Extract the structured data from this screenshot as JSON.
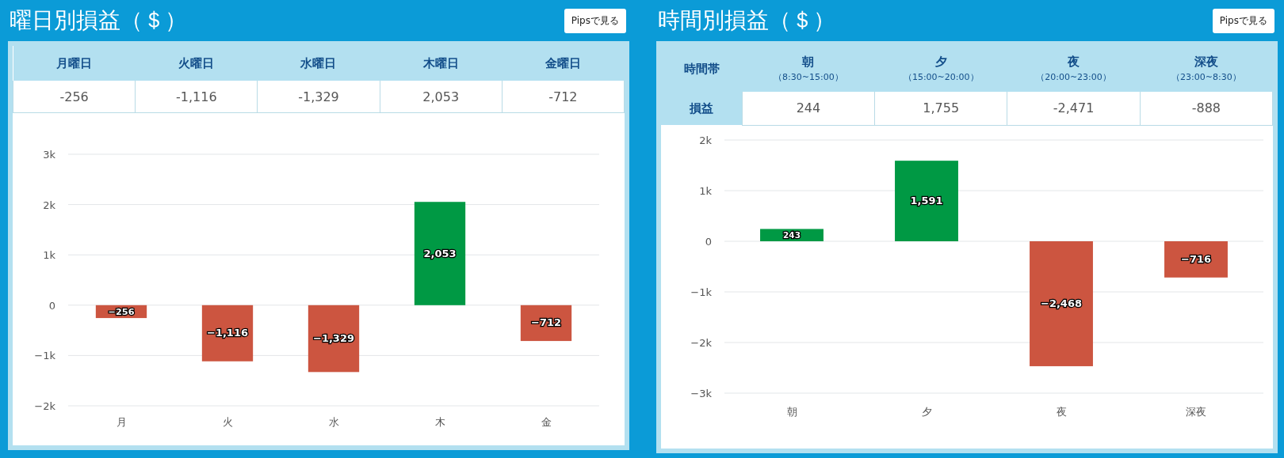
{
  "panels": [
    {
      "title": "曜日別損益（＄）",
      "button": "Pipsで見る",
      "table": {
        "columns": [
          "月曜日",
          "火曜日",
          "水曜日",
          "木曜日",
          "金曜日"
        ],
        "values": [
          "-256",
          "-1,116",
          "-1,329",
          "2,053",
          "-712"
        ]
      },
      "chart_data": {
        "type": "bar",
        "categories": [
          "月",
          "火",
          "水",
          "木",
          "金"
        ],
        "stacked": true,
        "grid": true,
        "series": [
          {
            "color": "#009944",
            "values": [
              null,
              null,
              null,
              2053,
              null
            ]
          },
          {
            "color": "#cc5540",
            "values": [
              -256,
              -1116,
              -1329,
              null,
              -712
            ]
          }
        ],
        "value_labels": [
          "−256",
          "−1,116",
          "−1,329",
          "2,053",
          "−712"
        ],
        "ylim": [
          -2000,
          3000
        ],
        "yticks": [
          {
            "value": -2000,
            "label": "−2k"
          },
          {
            "value": -1000,
            "label": "−1k"
          },
          0,
          {
            "value": 1000,
            "label": "1k"
          },
          {
            "value": 2000,
            "label": "2k"
          },
          {
            "value": 3000,
            "label": "3k"
          }
        ]
      }
    },
    {
      "title": "時間別損益（＄）",
      "button": "Pipsで見る",
      "table": {
        "corner": "時間帯",
        "row_header": "損益",
        "columns": [
          {
            "label": "朝",
            "sub": "（8:30~15:00）"
          },
          {
            "label": "夕",
            "sub": "（15:00~20:00）"
          },
          {
            "label": "夜",
            "sub": "（20:00~23:00）"
          },
          {
            "label": "深夜",
            "sub": "（23:00~8:30）"
          }
        ],
        "values": [
          "244",
          "1,755",
          "-2,471",
          "-888"
        ]
      },
      "chart_data": {
        "type": "bar",
        "categories": [
          "朝",
          "夕",
          "夜",
          "深夜"
        ],
        "stacked": true,
        "grid": true,
        "series": [
          {
            "color": "#009944",
            "values": [
              243,
              1591,
              null,
              null
            ]
          },
          {
            "color": "#cc5540",
            "values": [
              null,
              null,
              -2468,
              -716
            ]
          }
        ],
        "value_labels": [
          "243",
          "1,591",
          "−2,468",
          "−716"
        ],
        "ylim": [
          -3000,
          2000
        ],
        "yticks": [
          {
            "value": -3000,
            "label": "−3k"
          },
          {
            "value": -2000,
            "label": "−2k"
          },
          {
            "value": -1000,
            "label": "−1k"
          },
          0,
          {
            "value": 1000,
            "label": "1k"
          },
          {
            "value": 2000,
            "label": "2k"
          }
        ]
      }
    }
  ]
}
